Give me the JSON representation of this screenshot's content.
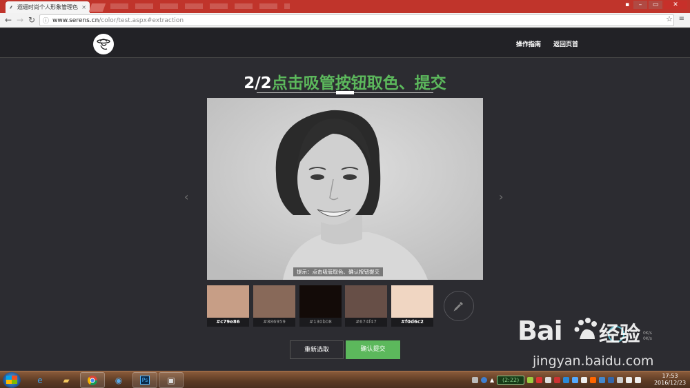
{
  "browser": {
    "tab_title": "遐逦时尚个人形象管理色",
    "url_host": "www.serens.cn",
    "url_path": "/color/test.aspx#extraction",
    "tab_close": "×",
    "window_minimize": "–",
    "window_maximize": "▭",
    "window_close": "✕"
  },
  "header": {
    "nav": [
      "操作指南",
      "返回页首"
    ]
  },
  "main": {
    "step": "2/2",
    "title": "点击吸管按钮取色、提交",
    "hint": "提示：点击吸管取色、确认按钮提交",
    "prev_arrow": "‹",
    "next_arrow": "›"
  },
  "swatches": [
    {
      "color": "#c79e86",
      "label": "#c79e86"
    },
    {
      "color": "#886959",
      "label": "#886959"
    },
    {
      "color": "#130b08",
      "label": "#130b08"
    },
    {
      "color": "#674f47",
      "label": "#674f47"
    },
    {
      "color": "#f0d6c2",
      "label": "#f0d6c2"
    }
  ],
  "picker_icon": "eyedropper-icon",
  "buttons": {
    "reset": "重新选取",
    "submit": "确认提交"
  },
  "colors": {
    "accent": "#5cb85c",
    "page_bg": "#2c2c31",
    "header_bg": "#222226"
  },
  "watermark": {
    "brand": "Bai",
    "brand2": "经验",
    "url": "jingyan.baidu.com"
  },
  "taskbar": {
    "battery": "(2:22)",
    "time": "17:53",
    "date": "2016/12/23"
  }
}
